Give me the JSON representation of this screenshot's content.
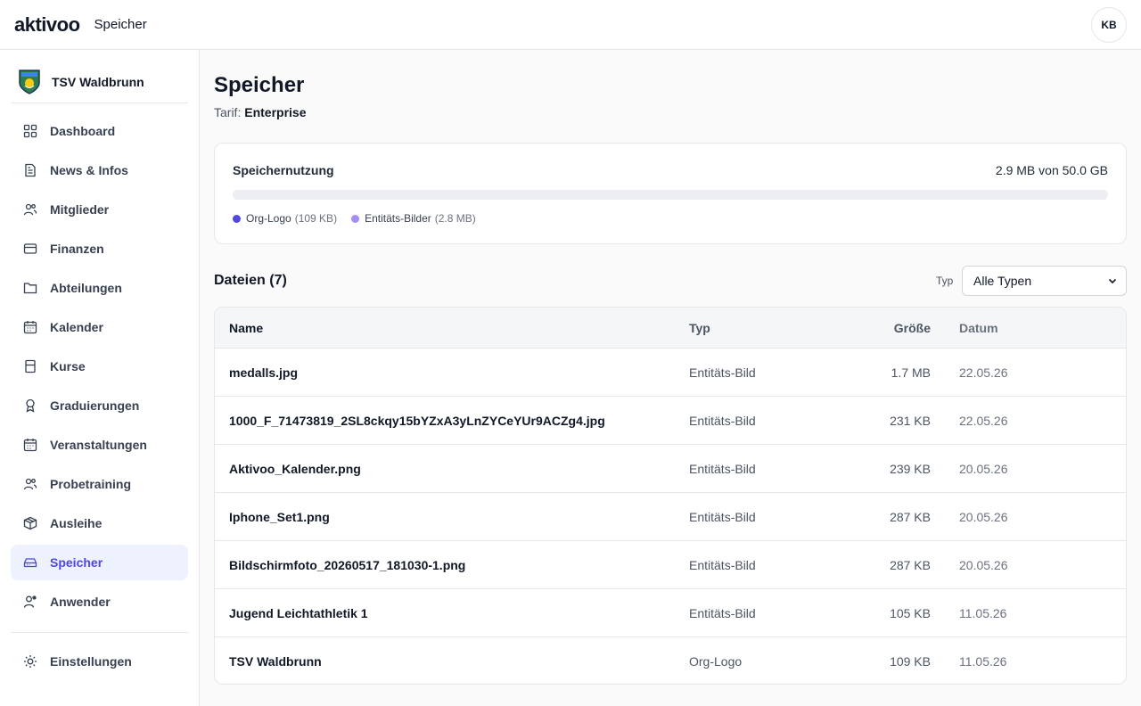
{
  "topbar": {
    "logo": "aktivoo",
    "title": "Speicher",
    "avatar_initials": "KB"
  },
  "org": {
    "name": "TSV Waldbrunn"
  },
  "sidebar": {
    "items": [
      {
        "label": "Dashboard",
        "icon": "grid-icon"
      },
      {
        "label": "News & Infos",
        "icon": "document-icon"
      },
      {
        "label": "Mitglieder",
        "icon": "users-icon"
      },
      {
        "label": "Finanzen",
        "icon": "credit-card-icon"
      },
      {
        "label": "Abteilungen",
        "icon": "folder-icon"
      },
      {
        "label": "Kalender",
        "icon": "calendar-icon"
      },
      {
        "label": "Kurse",
        "icon": "book-icon"
      },
      {
        "label": "Graduierungen",
        "icon": "award-icon"
      },
      {
        "label": "Veranstaltungen",
        "icon": "calendar-icon"
      },
      {
        "label": "Probetraining",
        "icon": "users-icon"
      },
      {
        "label": "Ausleihe",
        "icon": "package-icon"
      },
      {
        "label": "Speicher",
        "icon": "hard-drive-icon",
        "active": true
      },
      {
        "label": "Anwender",
        "icon": "user-cog-icon"
      }
    ],
    "settings": {
      "label": "Einstellungen",
      "icon": "sun-gear-icon"
    }
  },
  "page": {
    "title": "Speicher",
    "plan_label": "Tarif:",
    "plan_value": "Enterprise"
  },
  "usage": {
    "label": "Speichernutzung",
    "amount": "2.9 MB von 50.0 GB",
    "used_fraction": 5.8e-05,
    "legend": [
      {
        "label": "Org-Logo",
        "size": "(109 KB)",
        "color": "#4f46e5"
      },
      {
        "label": "Entitäts-Bilder",
        "size": "(2.8 MB)",
        "color": "#a78bfa"
      }
    ]
  },
  "files": {
    "title": "Dateien (7)",
    "filter_label": "Typ",
    "filter_selected": "Alle Typen",
    "columns": {
      "name": "Name",
      "typ": "Typ",
      "size": "Größe",
      "date": "Datum"
    },
    "rows": [
      {
        "name": "medalls.jpg",
        "typ": "Entitäts-Bild",
        "size": "1.7 MB",
        "date": "22.05.26"
      },
      {
        "name": "1000_F_71473819_2SL8ckqy15bYZxA3yLnZYCeYUr9ACZg4.jpg",
        "typ": "Entitäts-Bild",
        "size": "231 KB",
        "date": "22.05.26"
      },
      {
        "name": "Aktivoo_Kalender.png",
        "typ": "Entitäts-Bild",
        "size": "239 KB",
        "date": "20.05.26"
      },
      {
        "name": "Iphone_Set1.png",
        "typ": "Entitäts-Bild",
        "size": "287 KB",
        "date": "20.05.26"
      },
      {
        "name": "Bildschirmfoto_20260517_181030-1.png",
        "typ": "Entitäts-Bild",
        "size": "287 KB",
        "date": "20.05.26"
      },
      {
        "name": "Jugend Leichtathletik 1",
        "typ": "Entitäts-Bild",
        "size": "105 KB",
        "date": "11.05.26"
      },
      {
        "name": "TSV Waldbrunn",
        "typ": "Org-Logo",
        "size": "109 KB",
        "date": "11.05.26"
      }
    ]
  }
}
